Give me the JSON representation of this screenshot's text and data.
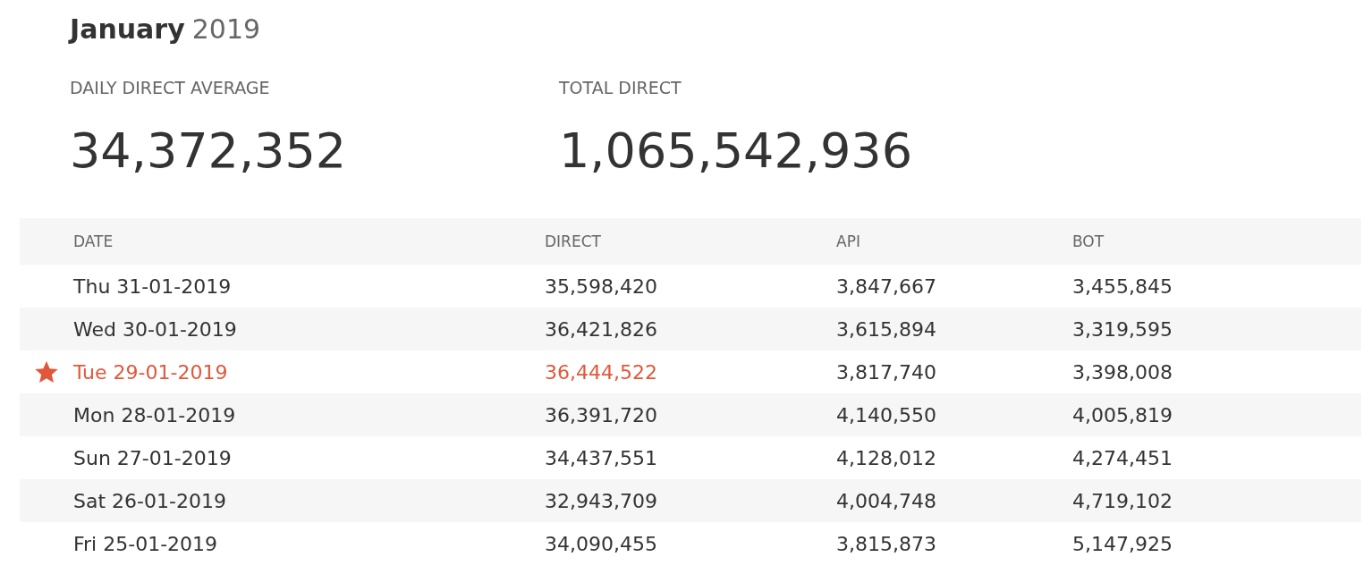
{
  "heading": {
    "month": "January",
    "year": "2019"
  },
  "stats": [
    {
      "label": "DAILY DIRECT AVERAGE",
      "value": "34,372,352"
    },
    {
      "label": "TOTAL DIRECT",
      "value": "1,065,542,936"
    }
  ],
  "table": {
    "columns": [
      "DATE",
      "DIRECT",
      "API",
      "BOT"
    ],
    "rows": [
      {
        "starred": false,
        "cells": [
          "Thu 31-01-2019",
          "35,598,420",
          "3,847,667",
          "3,455,845"
        ]
      },
      {
        "starred": false,
        "cells": [
          "Wed 30-01-2019",
          "36,421,826",
          "3,615,894",
          "3,319,595"
        ]
      },
      {
        "starred": true,
        "cells": [
          "Tue 29-01-2019",
          "36,444,522",
          "3,817,740",
          "3,398,008"
        ]
      },
      {
        "starred": false,
        "cells": [
          "Mon 28-01-2019",
          "36,391,720",
          "4,140,550",
          "4,005,819"
        ]
      },
      {
        "starred": false,
        "cells": [
          "Sun 27-01-2019",
          "34,437,551",
          "4,128,012",
          "4,274,451"
        ]
      },
      {
        "starred": false,
        "cells": [
          "Sat 26-01-2019",
          "32,943,709",
          "4,004,748",
          "4,719,102"
        ]
      },
      {
        "starred": false,
        "cells": [
          "Fri 25-01-2019",
          "34,090,455",
          "3,815,873",
          "5,147,925"
        ]
      }
    ]
  }
}
